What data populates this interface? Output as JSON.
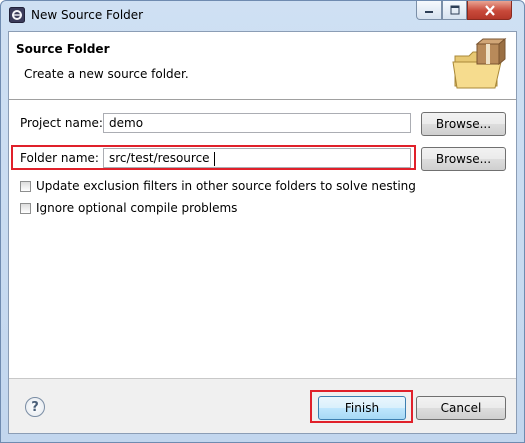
{
  "window": {
    "title": "New Source Folder",
    "app_icon": "eclipse-icon",
    "controls": [
      "minimize-icon",
      "maximize-icon",
      "close-icon"
    ]
  },
  "header": {
    "title": "Source Folder",
    "description": "Create a new source folder.",
    "icon": "folder-package-icon"
  },
  "form": {
    "project_label": "Project name:",
    "project_value": "demo",
    "project_browse": "Browse...",
    "folder_label": "Folder name:",
    "folder_value": "src/test/resource",
    "folder_browse": "Browse...",
    "options": [
      {
        "label": "Update exclusion filters in other source folders to solve nesting",
        "checked": false
      },
      {
        "label": "Ignore optional compile problems",
        "checked": false
      }
    ]
  },
  "footer": {
    "help_icon": "help-icon",
    "finish": "Finish",
    "cancel": "Cancel"
  },
  "colors": {
    "highlight": "#e0202a",
    "close_button": "#c8493a",
    "title_bar": "#cfe0f3"
  }
}
